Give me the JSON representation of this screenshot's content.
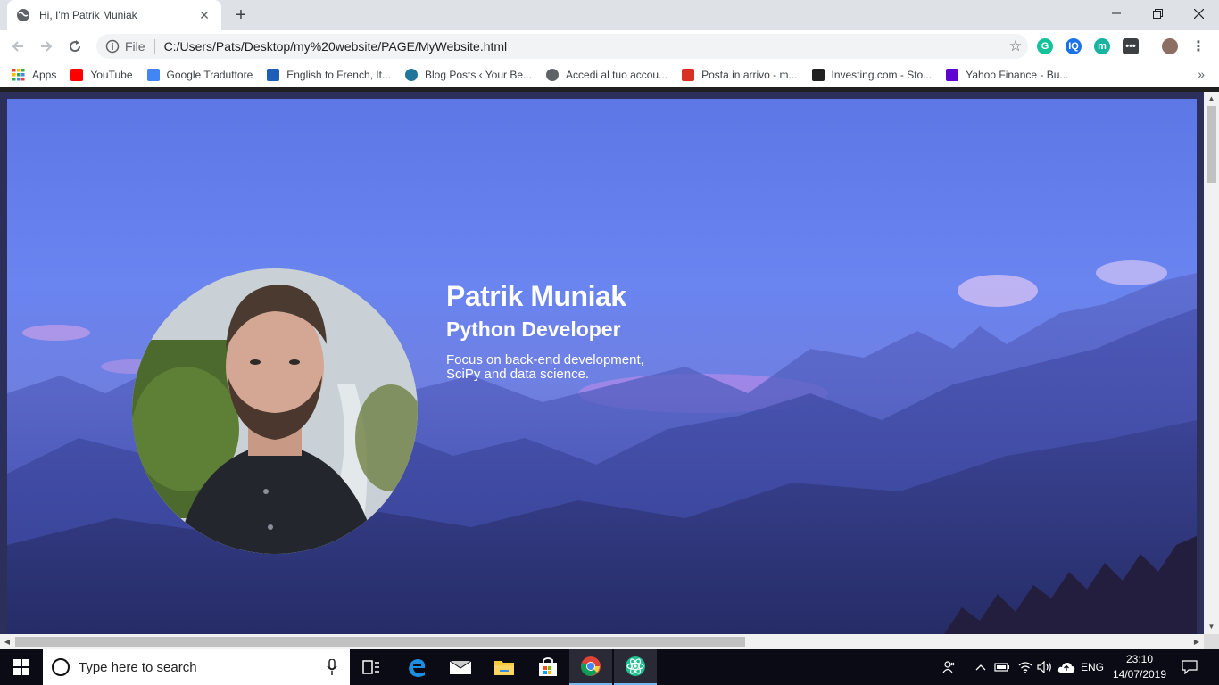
{
  "browser": {
    "tab_title": "Hi, I'm Patrik Muniak",
    "address_prefix": "File",
    "url": "C:/Users/Pats/Desktop/my%20website/PAGE/MyWebsite.html",
    "window_controls": [
      "minimize",
      "restore",
      "close"
    ],
    "extensions": [
      {
        "name": "grammarly-icon",
        "label": "G",
        "color": "#15c39a"
      },
      {
        "name": "iq-extension-icon",
        "label": "IQ",
        "color": "#1a73e8"
      },
      {
        "name": "m-extension-icon",
        "label": "m",
        "color": "#18b4a0"
      },
      {
        "name": "more-extension-icon",
        "label": "•••",
        "color": "#3c4043"
      }
    ]
  },
  "bookmarks": [
    {
      "label": "Apps",
      "icon": "apps-grid-icon",
      "color": "#ea4335"
    },
    {
      "label": "YouTube",
      "icon": "youtube-icon",
      "color": "#ff0000"
    },
    {
      "label": "Google Traduttore",
      "icon": "google-translate-icon",
      "color": "#4285f4"
    },
    {
      "label": "English to French, It...",
      "icon": "wordreference-icon",
      "color": "#1d5fb8"
    },
    {
      "label": "Blog Posts ‹ Your Be...",
      "icon": "wordpress-icon",
      "color": "#21759b"
    },
    {
      "label": "Accedi al tuo accou...",
      "icon": "globe-icon",
      "color": "#5f6368"
    },
    {
      "label": "Posta in arrivo - m...",
      "icon": "gmail-icon",
      "color": "#d93025"
    },
    {
      "label": "Investing.com - Sto...",
      "icon": "investing-icon",
      "color": "#222222"
    },
    {
      "label": "Yahoo Finance - Bu...",
      "icon": "yahoo-icon",
      "color": "#5f01d1"
    }
  ],
  "hero": {
    "name": "Patrik Muniak",
    "role": "Python Developer",
    "description_line1": "Focus on back-end development,",
    "description_line2": "SciPy and data science."
  },
  "taskbar": {
    "search_placeholder": "Type here to search",
    "language": "ENG",
    "time": "23:10",
    "date": "14/07/2019"
  }
}
